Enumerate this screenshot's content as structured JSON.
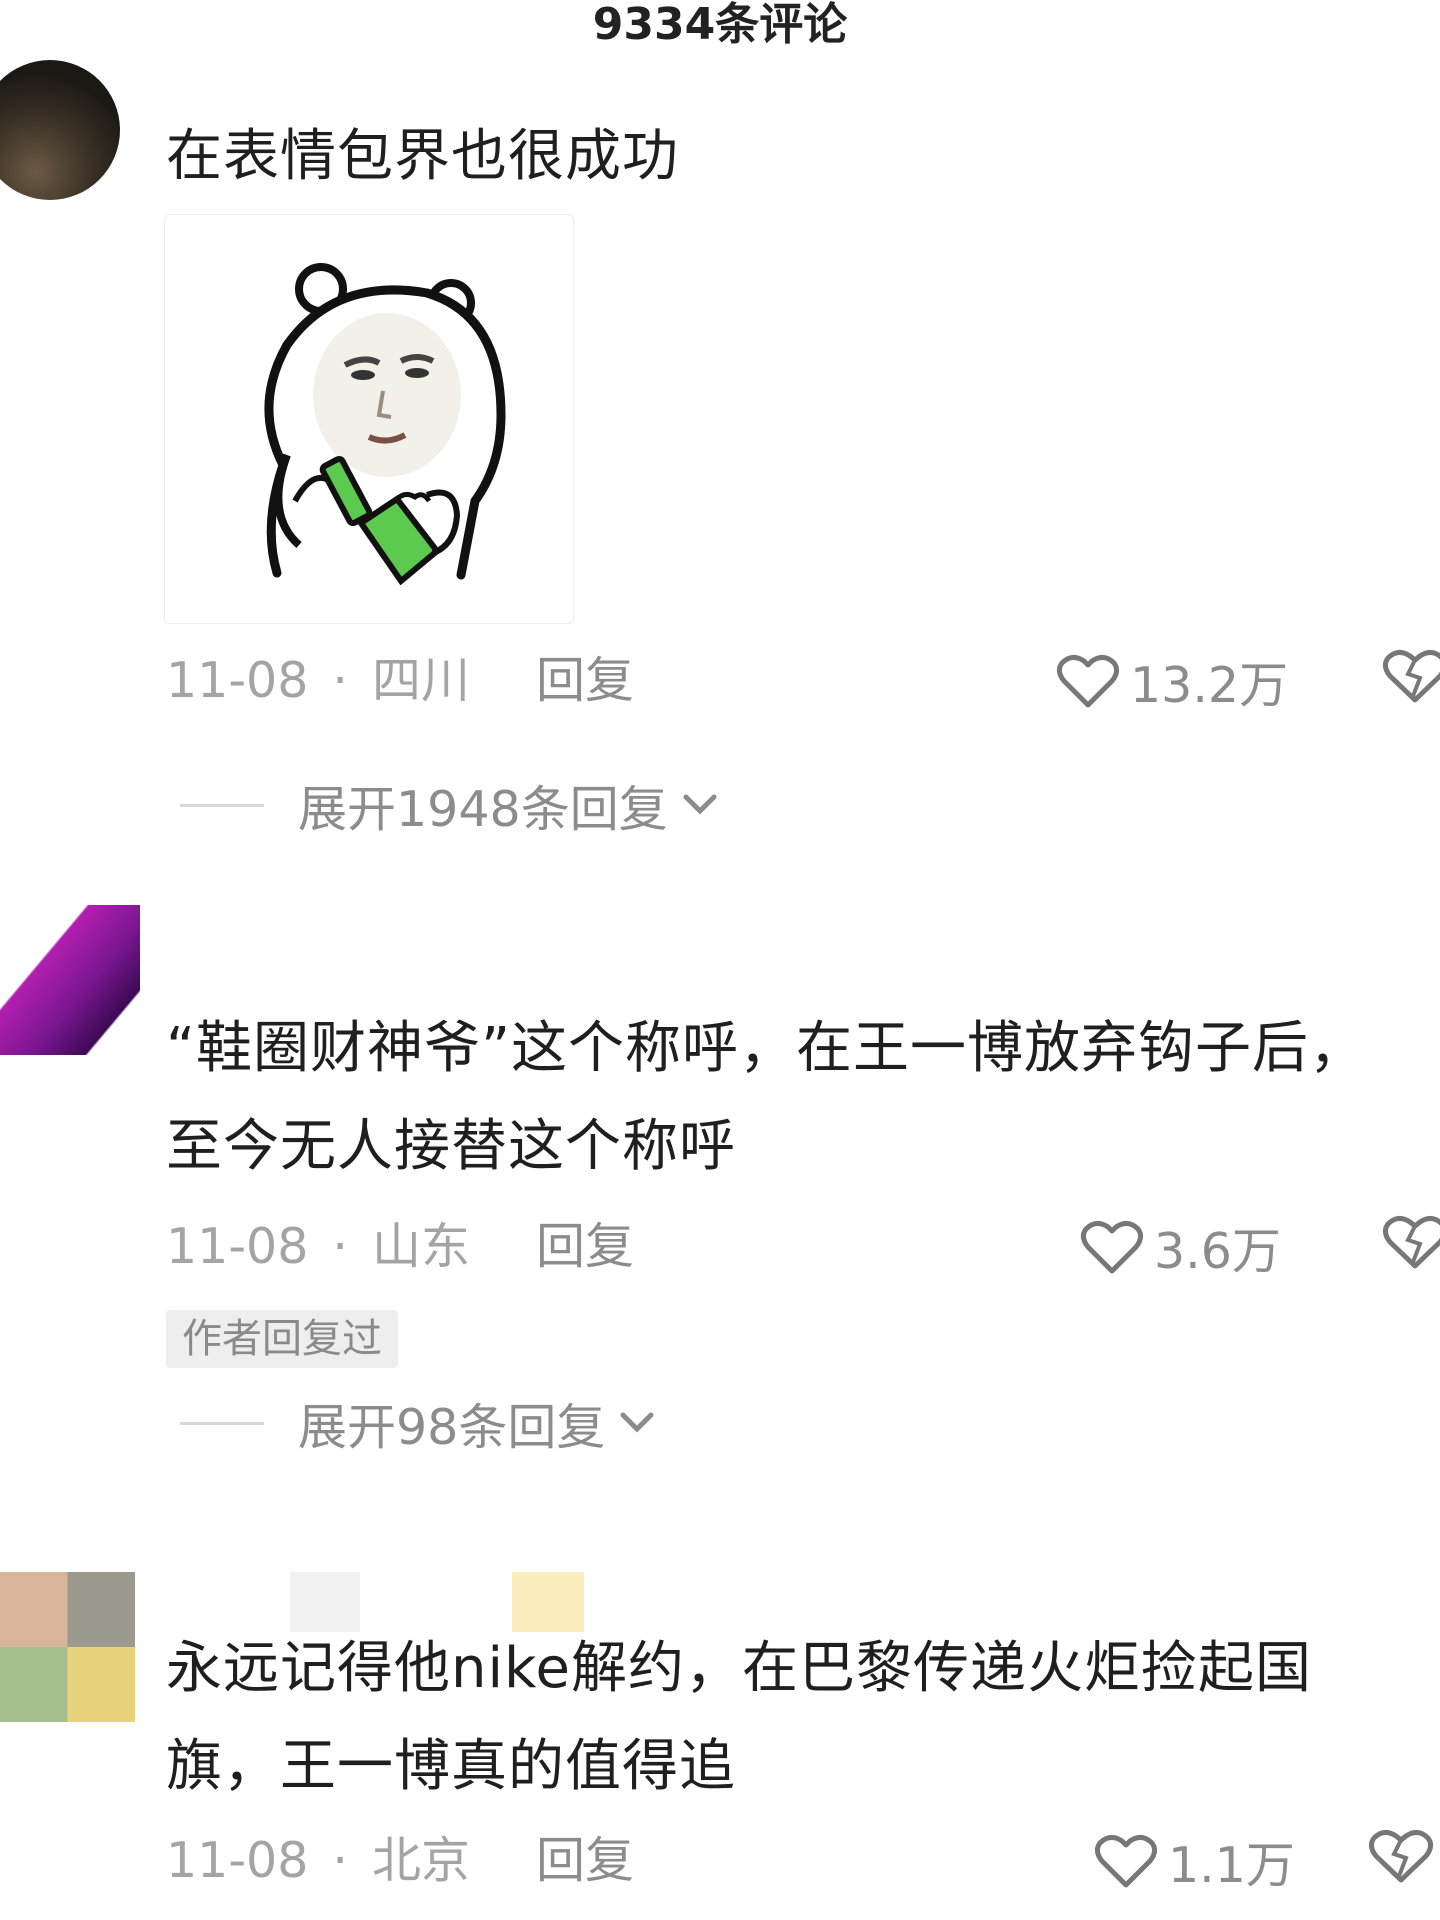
{
  "header": {
    "title": "9334条评论"
  },
  "comments": [
    {
      "text_lines": [
        "在表情包界也很成功"
      ],
      "has_sticker": true,
      "date": "11-08",
      "location": "四川",
      "reply_label": "回复",
      "likes": "13.2万",
      "expand_label": "展开1948条回复"
    },
    {
      "text_lines": [
        "“鞋圈财神爷”这个称呼，在王一博放弃钩子后，",
        "至今无人接替这个称呼"
      ],
      "date": "11-08",
      "location": "山东",
      "reply_label": "回复",
      "likes": "3.6万",
      "author_badge": "作者回复过",
      "expand_label": "展开98条回复"
    },
    {
      "text_lines": [
        "永远记得他nike解约，在巴黎传递火炬捡起国",
        "旗，王一博真的值得追"
      ],
      "date": "11-08",
      "location": "北京",
      "reply_label": "回复",
      "likes": "1.1万"
    }
  ],
  "icons": {
    "like": "heart-outline-icon",
    "dislike": "broken-heart-icon",
    "expand": "chevron-down-icon"
  },
  "colors": {
    "meta_gray": "#a4a4a4",
    "sticker_green": "#5cc94f"
  }
}
